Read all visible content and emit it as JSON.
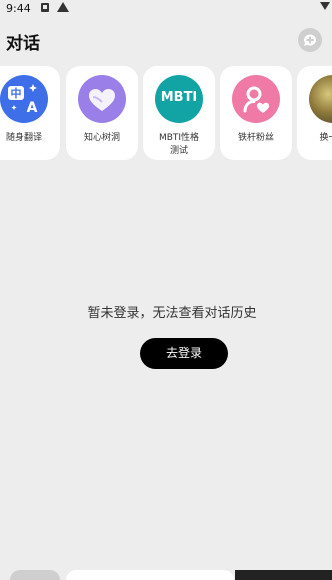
{
  "status": {
    "time": "9:44"
  },
  "header": {
    "title": "对话"
  },
  "shortcuts": [
    {
      "label": "随身翻译",
      "icon": "translate-icon"
    },
    {
      "label": "知心树洞",
      "icon": "heart-icon"
    },
    {
      "label_line1": "MBTI性格",
      "label_line2": "测试",
      "icon_text": "MBTI",
      "icon": "mbti-icon"
    },
    {
      "label": "铁杆粉丝",
      "icon": "fan-icon"
    },
    {
      "label": "换一种",
      "icon": "avatar-icon"
    }
  ],
  "empty_state": {
    "message": "暂未登录，无法查看对话历史",
    "login_label": "去登录"
  },
  "colors": {
    "background": "#ededed",
    "translate": "#3f6fe8",
    "heart": "#9b7fe8",
    "mbti": "#12a3a5",
    "fan": "#f07aa6",
    "button": "#000000"
  }
}
